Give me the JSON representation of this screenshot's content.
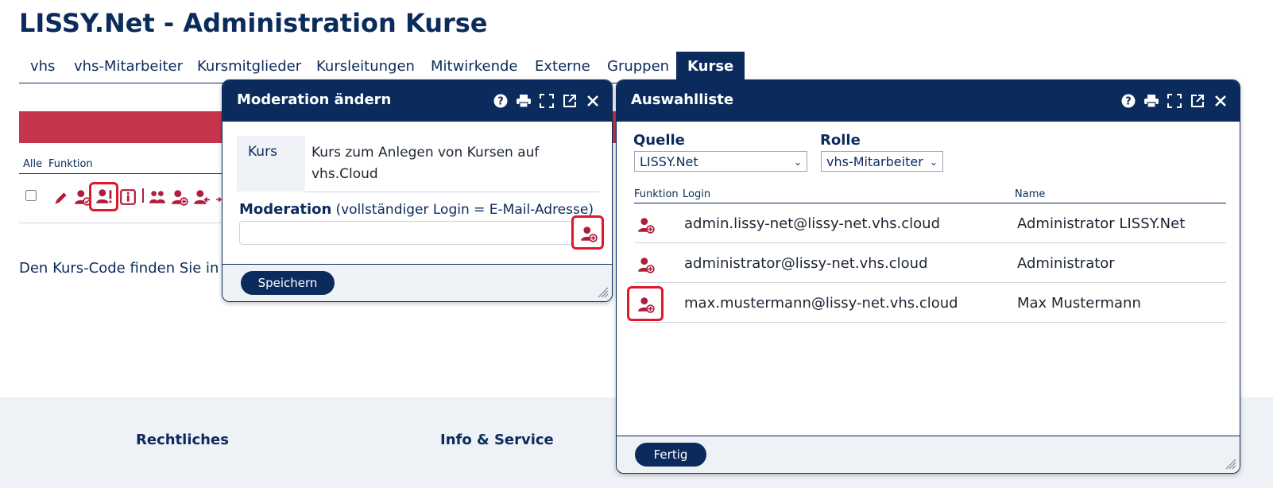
{
  "page": {
    "title": "LISSY.Net - Administration Kurse"
  },
  "tabs": [
    {
      "label": "vhs"
    },
    {
      "label": "vhs-Mitarbeiter"
    },
    {
      "label": "Kursmitglieder"
    },
    {
      "label": "Kursleitungen"
    },
    {
      "label": "Mitwirkende"
    },
    {
      "label": "Externe"
    },
    {
      "label": "Gruppen"
    },
    {
      "label": "Kurse",
      "active": true
    }
  ],
  "list": {
    "col_all": "Alle",
    "col_function": "Funktion",
    "row_icons": [
      "edit-icon",
      "user-check-icon",
      "user-moderator-icon",
      "info-icon",
      "users-icon",
      "user-add-icon",
      "user-import-icon"
    ]
  },
  "hint": "Den Kurs-Code finden Sie in de",
  "footer": {
    "col1": "Rechtliches",
    "col2": "Info & Service"
  },
  "moderation_dialog": {
    "title": "Moderation ändern",
    "kurs_label": "Kurs",
    "kurs_value": "Kurs zum Anlegen von Kursen auf vhs.Cloud",
    "moderation_label": "Moderation",
    "moderation_hint": "(vollständiger Login = E-Mail-Adresse)",
    "moderation_value": "",
    "save_button": "Speichern"
  },
  "picklist_dialog": {
    "title": "Auswahlliste",
    "source_label": "Quelle",
    "source_value": "LISSY.Net",
    "role_label": "Rolle",
    "role_value": "vhs-Mitarbeiter",
    "columns": {
      "function": "Funktion",
      "login": "Login",
      "name": "Name"
    },
    "rows": [
      {
        "login": "admin.lissy-net@lissy-net.vhs.cloud",
        "name": "Administrator LISSY.Net"
      },
      {
        "login": "administrator@lissy-net.vhs.cloud",
        "name": "Administrator"
      },
      {
        "login": "max.mustermann@lissy-net.vhs.cloud",
        "name": "Max Mustermann"
      }
    ],
    "done_button": "Fertig"
  },
  "colors": {
    "navy": "#0b2b5c",
    "crimson": "#b01c3c",
    "highlight": "#e0182c",
    "banner": "#c7344d"
  }
}
